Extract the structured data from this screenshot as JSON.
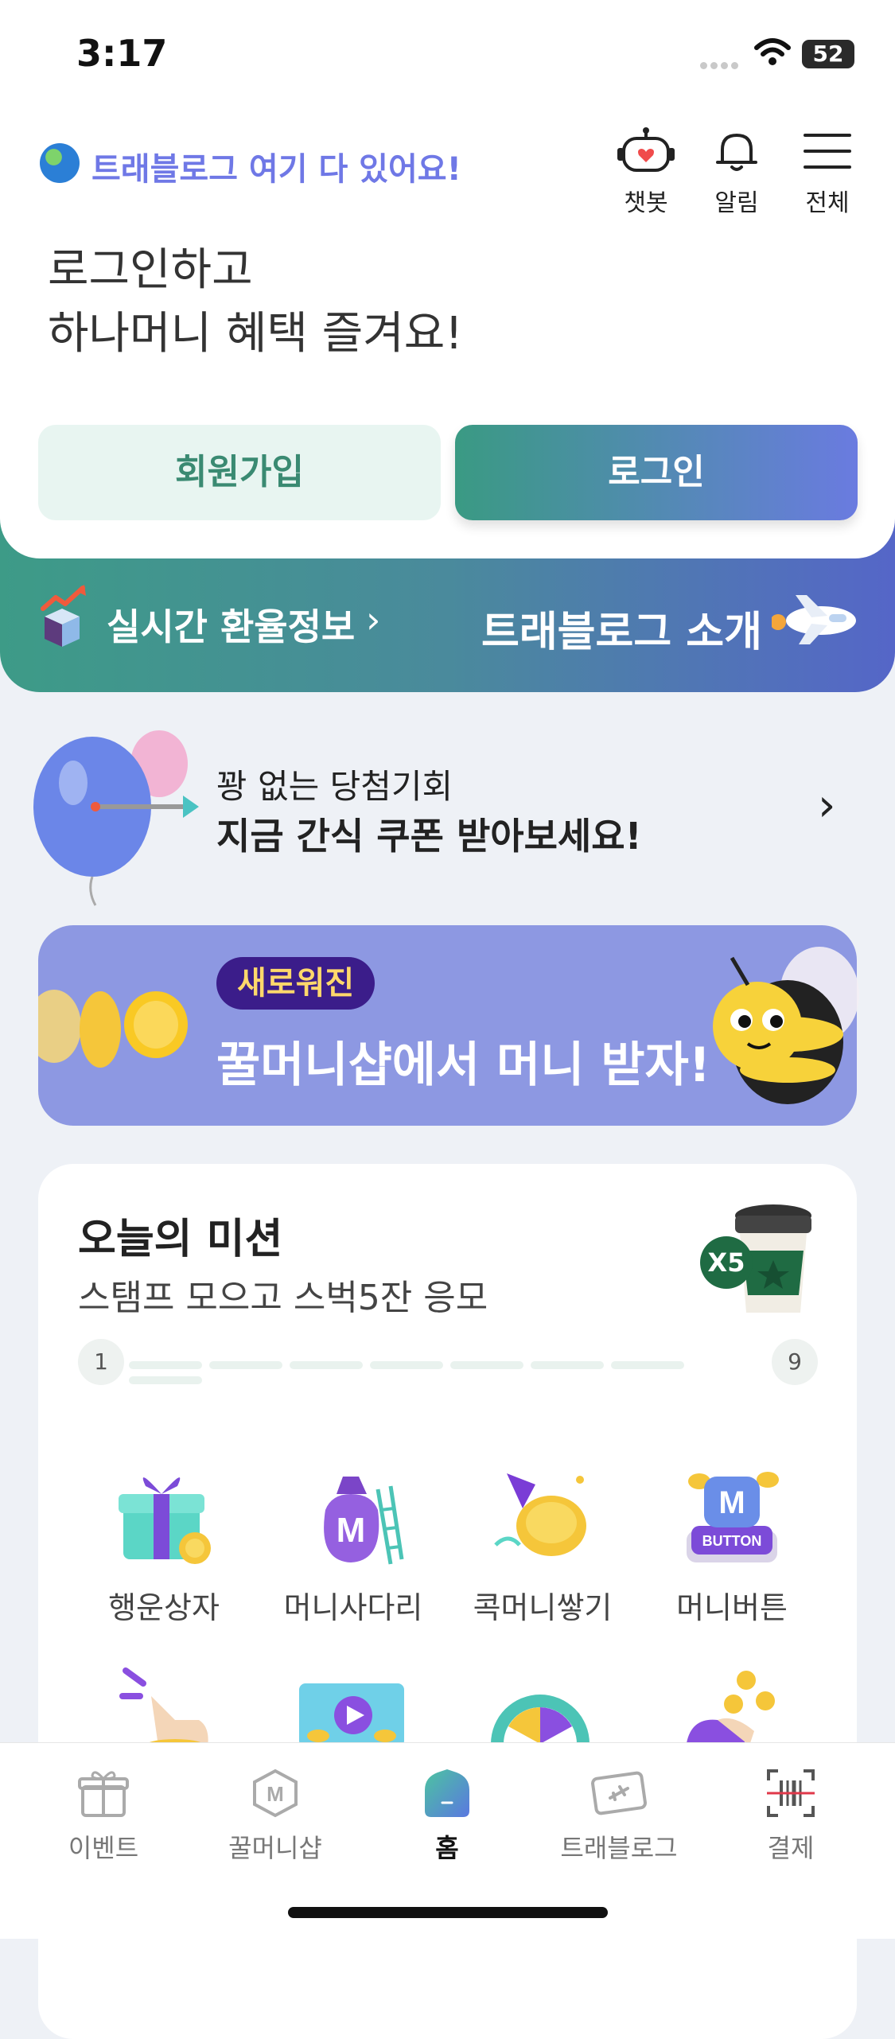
{
  "status_bar": {
    "time": "3:17",
    "battery": "52"
  },
  "header": {
    "brand_text": "트래블로그 여기 다 있어요!",
    "icons": [
      {
        "name": "chatbot-icon",
        "label": "챗봇"
      },
      {
        "name": "bell-icon",
        "label": "알림"
      },
      {
        "name": "menu-icon",
        "label": "전체"
      }
    ]
  },
  "login": {
    "prompt_line1": "로그인하고",
    "prompt_line2": "하나머니 혜택 즐겨요!",
    "signup_label": "회원가입",
    "login_label": "로그인"
  },
  "strip": {
    "exchange_label": "실시간 환율정보",
    "exchange_chevron": "›",
    "intro_label": "트래블로그 소개"
  },
  "promo": {
    "line1": "꽝 없는 당첨기회",
    "line2": "지금 간식 쿠폰 받아보세요!",
    "chevron": "›"
  },
  "honey_banner": {
    "badge": "새로워진",
    "title": "꿀머니샵에서 머니 받자!"
  },
  "mission": {
    "title": "오늘의 미션",
    "subtitle": "스탬프 모으고 스벅5잔 응모",
    "cup_badge": "X5",
    "progress_start": "1",
    "progress_end": "9",
    "progress_fraction": 0,
    "items": [
      {
        "label": "행운상자",
        "icon": "gift-box-icon"
      },
      {
        "label": "머니사다리",
        "icon": "money-bag-ladder-icon"
      },
      {
        "label": "콕머니쌓기",
        "icon": "coin-stack-icon"
      },
      {
        "label": "머니버튼",
        "icon": "money-button-icon"
      }
    ],
    "button_badge": "BUTTON",
    "bag_letter": "M"
  },
  "tabbar": {
    "tabs": [
      {
        "label": "이벤트",
        "icon": "gift-icon"
      },
      {
        "label": "꿀머니샵",
        "icon": "hexagon-m-icon"
      },
      {
        "label": "홈",
        "icon": "home-icon"
      },
      {
        "label": "트래블로그",
        "icon": "travel-card-icon"
      },
      {
        "label": "결제",
        "icon": "barcode-scan-icon"
      }
    ],
    "active": "홈"
  },
  "colors": {
    "brand_purple": "#6f78e6",
    "primary_green": "#3a9a83",
    "banner_purple": "#8d98e2",
    "badge_navy": "#3b1d8a"
  }
}
